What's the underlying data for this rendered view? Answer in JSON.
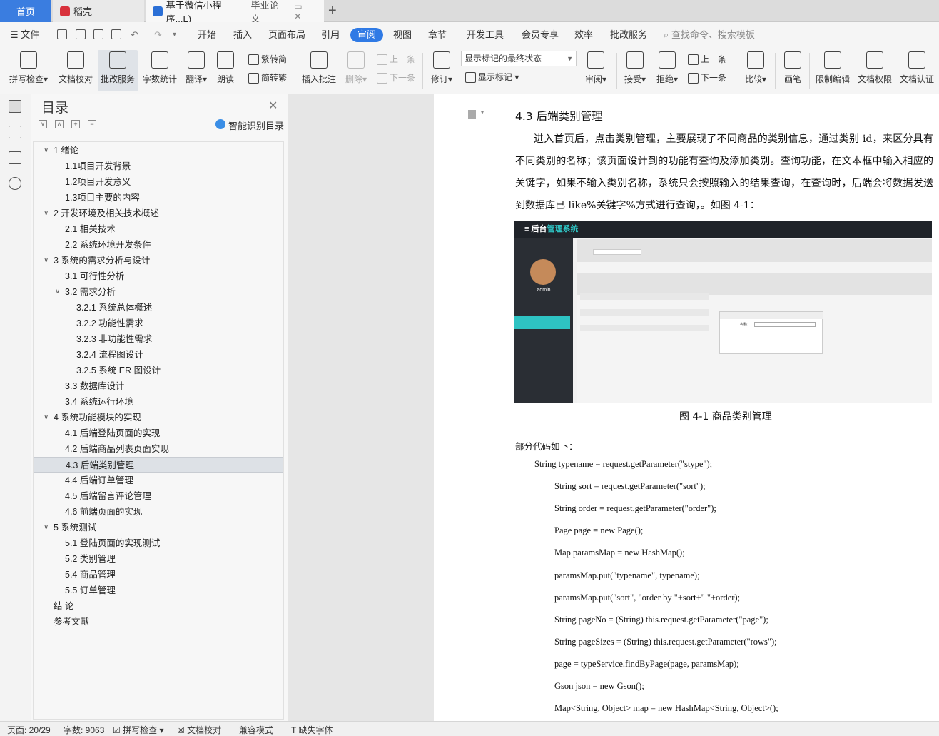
{
  "tabs": {
    "home": "首页",
    "daoke": "稻壳",
    "doc_name": "基于微信小程序...L)",
    "doc_tag": "毕业论文"
  },
  "menu": {
    "file": "文件",
    "items": [
      "开始",
      "插入",
      "页面布局",
      "引用",
      "审阅",
      "视图",
      "章节",
      "开发工具",
      "会员专享",
      "效率",
      "批改服务"
    ],
    "active": "审阅",
    "search_placeholder": "查找命令、搜索模板"
  },
  "ribbon": {
    "spell_check": "拼写检查",
    "doc_proof": "文档校对",
    "correction": "批改服务",
    "word_count": "字数统计",
    "translate": "翻译",
    "read_aloud": "朗读",
    "trad": "繁转简",
    "simp": "简转繁",
    "insert_comment": "插入批注",
    "delete": "删除",
    "prev_comment": "上一条",
    "next_comment": "下一条",
    "revise": "修订",
    "state_select": "显示标记的最终状态",
    "show_marks": "显示标记",
    "review": "审阅",
    "accept": "接受",
    "reject": "拒绝",
    "prev_change": "上一条",
    "next_change": "下一条",
    "compare": "比较",
    "pen": "画笔",
    "restrict_edit": "限制编辑",
    "doc_rights": "文档权限",
    "doc_cert": "文档认证"
  },
  "toc": {
    "title": "目录",
    "smart": "智能识别目录",
    "items": [
      {
        "label": "1  绪论",
        "level": 1,
        "arrow": "∨"
      },
      {
        "label": "1.1项目开发背景",
        "level": 2
      },
      {
        "label": "1.2项目开发意义",
        "level": 2
      },
      {
        "label": "1.3项目主要的内容",
        "level": 2
      },
      {
        "label": "2  开发环境及相关技术概述",
        "level": 1,
        "arrow": "∨"
      },
      {
        "label": "2.1  相关技术",
        "level": 2
      },
      {
        "label": "2.2  系统环境开发条件",
        "level": 2
      },
      {
        "label": "3  系统的需求分析与设计",
        "level": 1,
        "arrow": "∨"
      },
      {
        "label": "3.1 可行性分析",
        "level": 2
      },
      {
        "label": "3.2 需求分析",
        "level": 2,
        "arrow": "∨"
      },
      {
        "label": "3.2.1 系统总体概述",
        "level": 3
      },
      {
        "label": "3.2.2 功能性需求",
        "level": 3
      },
      {
        "label": "3.2.3 非功能性需求",
        "level": 3
      },
      {
        "label": "3.2.4 流程图设计",
        "level": 3
      },
      {
        "label": "3.2.5 系统 ER 图设计",
        "level": 3
      },
      {
        "label": "3.3  数据库设计",
        "level": 2
      },
      {
        "label": "3.4 系统运行环境",
        "level": 2
      },
      {
        "label": "4  系统功能模块的实现",
        "level": 1,
        "arrow": "∨"
      },
      {
        "label": "4.1  后端登陆页面的实现",
        "level": 2
      },
      {
        "label": "4.2 后端商品列表页面实现",
        "level": 2
      },
      {
        "label": "4.3  后端类别管理",
        "level": 2,
        "selected": true
      },
      {
        "label": "4.4  后端订单管理",
        "level": 2
      },
      {
        "label": "4.5  后端留言评论管理",
        "level": 2
      },
      {
        "label": "4.6  前端页面的实现",
        "level": 2
      },
      {
        "label": "5  系统测试",
        "level": 1,
        "arrow": "∨"
      },
      {
        "label": "5.1  登陆页面的实现测试",
        "level": 2
      },
      {
        "label": "5.2  类别管理",
        "level": 2
      },
      {
        "label": "5.4  商品管理",
        "level": 2
      },
      {
        "label": "5.5  订单管理",
        "level": 2
      },
      {
        "label": "结    论",
        "level": 1
      },
      {
        "label": "参考文献",
        "level": 1
      }
    ]
  },
  "document": {
    "heading": "4.3  后端类别管理",
    "paragraph": "进入首页后，点击类别管理，主要展现了不同商品的类别信息，通过类别 id，来区分具有不同类别的名称；该页面设计到的功能有查询及添加类别。查询功能，在文本框中输入相应的关键字，如果不输入类别名称，系统只会按照输入的结果查询，在查询时，后端会将数据发送到数据库已 like%关键字%方式进行查询，。如图 4-1：",
    "figure": {
      "brand_a": "后台",
      "brand_b": "管理系统",
      "user": "admin",
      "dialog_label": "名称："
    },
    "caption": "图 4-1 商品类别管理",
    "code_intro": "部分代码如下：",
    "code_lines": [
      "String typename = request.getParameter(\"stype\");",
      "String sort = request.getParameter(\"sort\");",
      "String order = request.getParameter(\"order\");",
      "Page page = new Page();",
      "Map paramsMap = new HashMap();",
      "paramsMap.put(\"typename\", typename);",
      "paramsMap.put(\"sort\", \"order by \"+sort+\" \"+order);",
      "String pageNo = (String) this.request.getParameter(\"page\");",
      "String pageSizes = (String) this.request.getParameter(\"rows\");",
      "page = typeService.findByPage(page, paramsMap);",
      "Gson json = new Gson();",
      "Map<String, Object> map = new HashMap<String, Object>();"
    ]
  },
  "status": {
    "page": "页面: 20/29",
    "words": "字数: 9063",
    "spell": "拼写检查",
    "proof": "文档校对",
    "compat": "兼容模式",
    "missing_font": "缺失字体"
  }
}
